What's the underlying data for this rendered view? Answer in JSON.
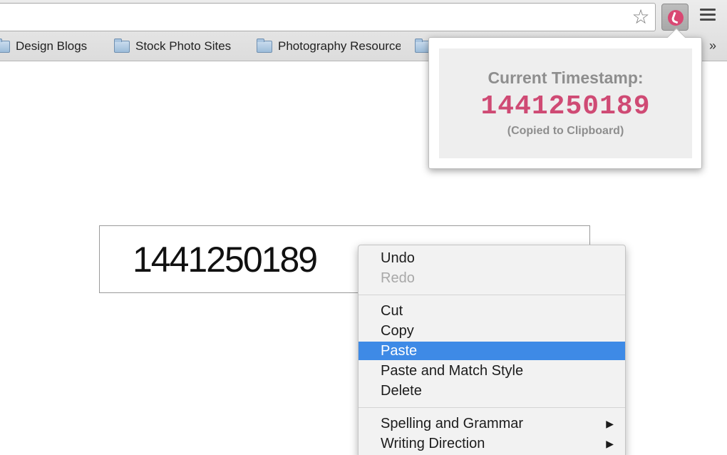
{
  "browser": {
    "bookmarks": [
      {
        "label": "Design Blogs"
      },
      {
        "label": "Stock Photo Sites"
      },
      {
        "label": "Photography Resources"
      }
    ],
    "overflow_label": "»"
  },
  "popup": {
    "title": "Current Timestamp:",
    "timestamp": "1441250189",
    "note": "(Copied to Clipboard)"
  },
  "page": {
    "input_value": "1441250189"
  },
  "context_menu": {
    "items": [
      {
        "label": "Undo",
        "state": "enabled"
      },
      {
        "label": "Redo",
        "state": "disabled"
      },
      {
        "label": "Cut",
        "state": "enabled"
      },
      {
        "label": "Copy",
        "state": "enabled"
      },
      {
        "label": "Paste",
        "state": "highlighted"
      },
      {
        "label": "Paste and Match Style",
        "state": "enabled"
      },
      {
        "label": "Delete",
        "state": "enabled"
      },
      {
        "label": "Spelling and Grammar",
        "state": "enabled",
        "submenu": true
      },
      {
        "label": "Writing Direction",
        "state": "enabled",
        "submenu": true
      }
    ]
  },
  "colors": {
    "accent": "#cf4a74",
    "selection": "#3e8ae6"
  }
}
